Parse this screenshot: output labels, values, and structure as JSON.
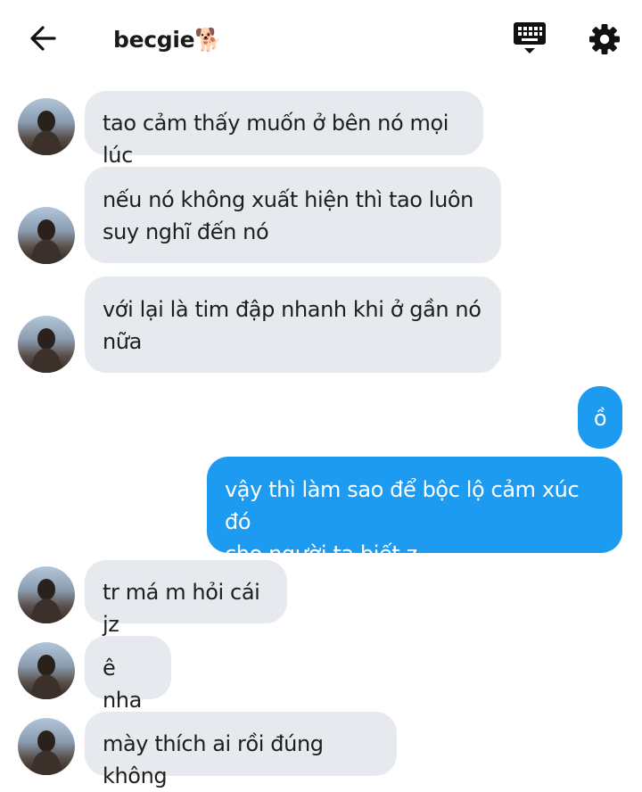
{
  "header": {
    "title": "becgie🐕",
    "icons": {
      "back": "arrow-left-icon",
      "keyboard": "keyboard-icon",
      "settings": "gear-icon"
    }
  },
  "messages": [
    {
      "from": "them",
      "text": "tao cảm thấy muốn ở bên nó mọi lúc"
    },
    {
      "from": "them",
      "text": "nếu nó không xuất hiện thì tao luôn\nsuy nghĩ đến nó"
    },
    {
      "from": "them",
      "text": "với lại là tim đập nhanh khi ở gần nó\nnữa"
    },
    {
      "from": "me",
      "text": "ồ"
    },
    {
      "from": "me",
      "text": "vậy thì làm sao để bộc lộ cảm xúc đó\ncho người ta biết z"
    },
    {
      "from": "them",
      "text": "tr má m hỏi cái jz"
    },
    {
      "from": "them",
      "text": "ê nha"
    },
    {
      "from": "them",
      "text": "mày thích ai rồi đúng không"
    }
  ],
  "colors": {
    "incoming_bubble": "#e6e9ee",
    "outgoing_bubble": "#1d9bf0"
  }
}
